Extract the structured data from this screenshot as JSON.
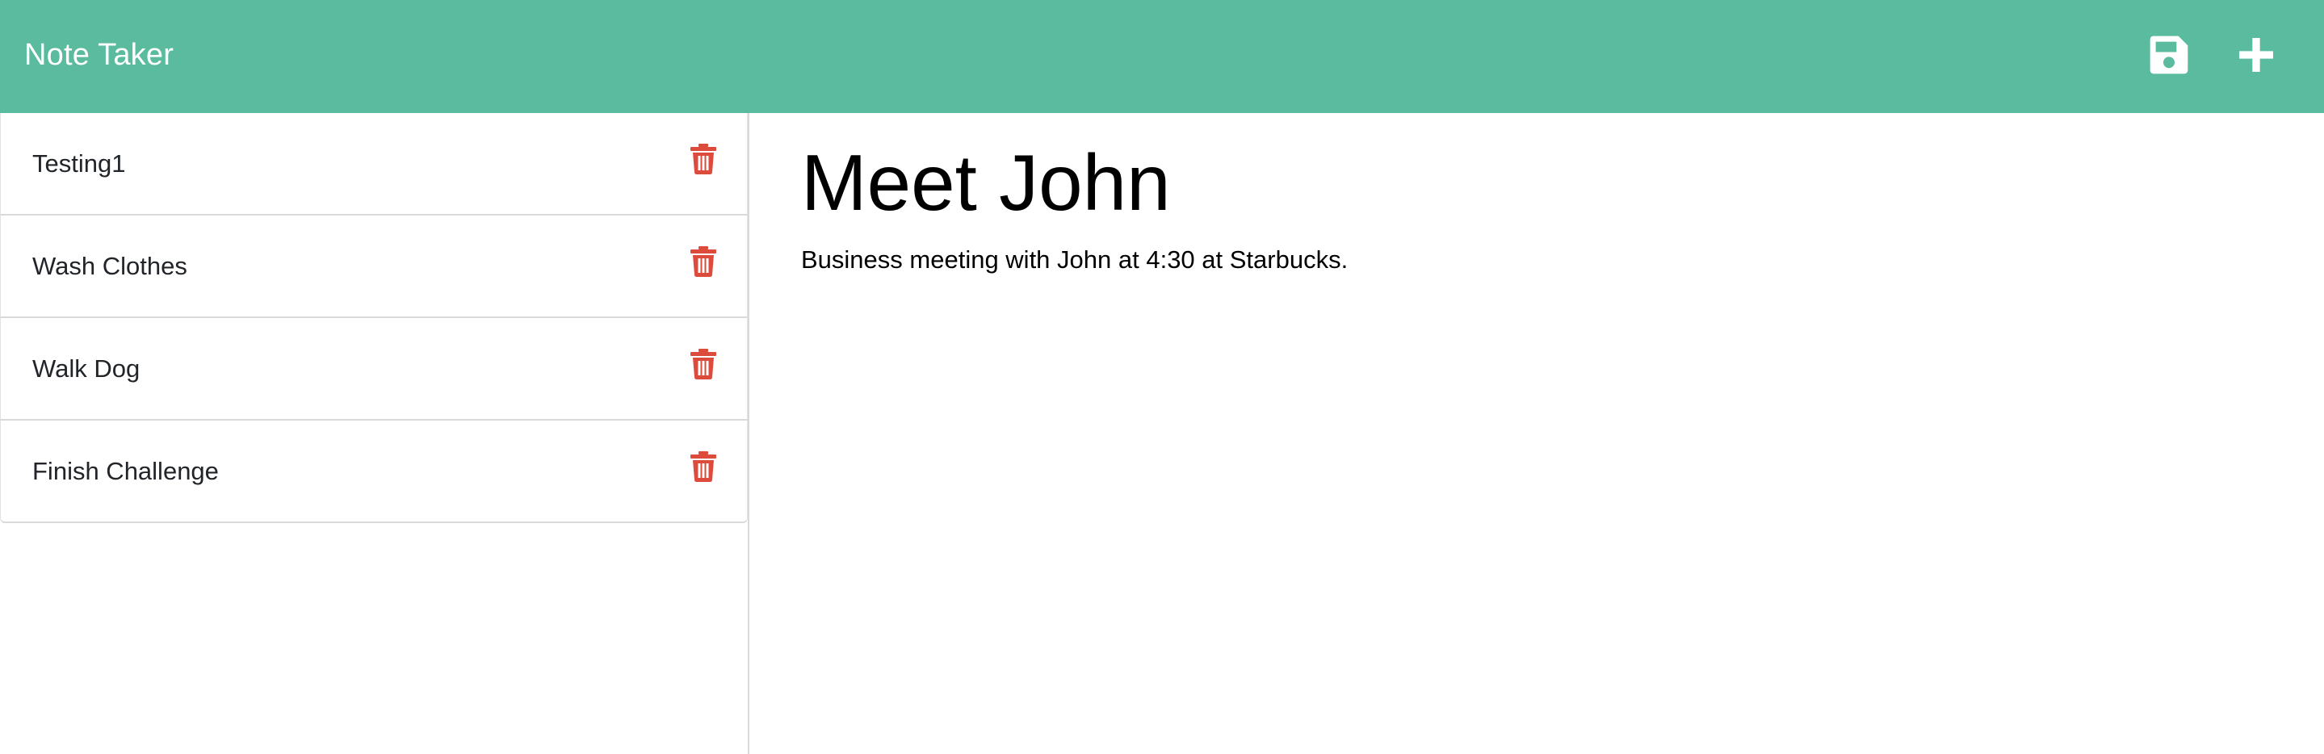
{
  "app": {
    "title": "Note Taker"
  },
  "toolbar": {
    "save_icon": "floppy-disk-icon",
    "new_icon": "plus-icon",
    "icon_color": "#ffffff"
  },
  "colors": {
    "navbar": "#5abb9e",
    "delete": "#dc4b3b"
  },
  "notes": [
    {
      "title": "Testing1"
    },
    {
      "title": "Wash Clothes"
    },
    {
      "title": "Walk Dog"
    },
    {
      "title": "Finish Challenge"
    }
  ],
  "active_note": {
    "title": "Meet John",
    "text": "Business meeting with John at 4:30 at Starbucks."
  }
}
